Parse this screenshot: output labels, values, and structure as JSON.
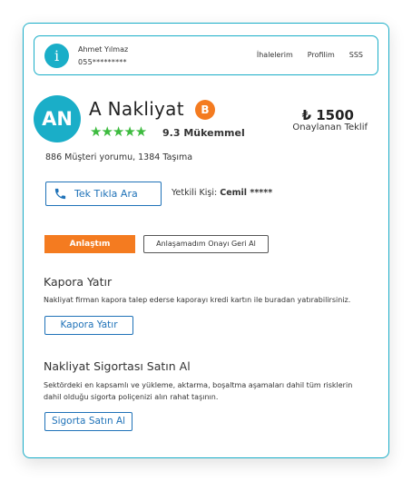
{
  "user": {
    "initial": "i",
    "name": "Ahmet Yılmaz",
    "phone": "055*********"
  },
  "nav": {
    "items": [
      "İhalelerim",
      "Profilim",
      "SSS"
    ]
  },
  "company": {
    "initials": "AN",
    "name": "A Nakliyat",
    "badge": "B",
    "stars": "★★★★★",
    "rating": "9.3 Mükemmel",
    "reviews_count": "886",
    "reviews_label": " Müşteri yorumu, ",
    "moves_count": "1384",
    "moves_label": " Taşıma"
  },
  "offer": {
    "price": "₺ 1500",
    "label": "Onaylanan Teklif"
  },
  "contact": {
    "call_button": "Tek Tıkla Ara",
    "person_label": "Yetkili Kişi: ",
    "person_name": "Cemil *****"
  },
  "actions": {
    "deal": "Anlaştım",
    "undo": "Anlaşamadım Onayı Geri Al"
  },
  "deposit": {
    "title": "Kapora Yatır",
    "text": "Nakliyat firman kapora talep ederse kaporayı kredi kartın ile buradan yatırabilirsiniz.",
    "button": "Kapora Yatır"
  },
  "insurance": {
    "title": "Nakliyat Sigortası Satın Al",
    "text": "Sektördeki en kapsamlı ve yükleme, aktarma, boşaltma aşamaları dahil tüm risklerin dahil olduğu sigorta poliçenizi alın rahat taşının.",
    "button": "Sigorta Satın Al"
  },
  "colors": {
    "accent": "#1aaec8",
    "primary": "#1f72b8",
    "orange": "#f47b20",
    "star": "#3dbb3f"
  }
}
